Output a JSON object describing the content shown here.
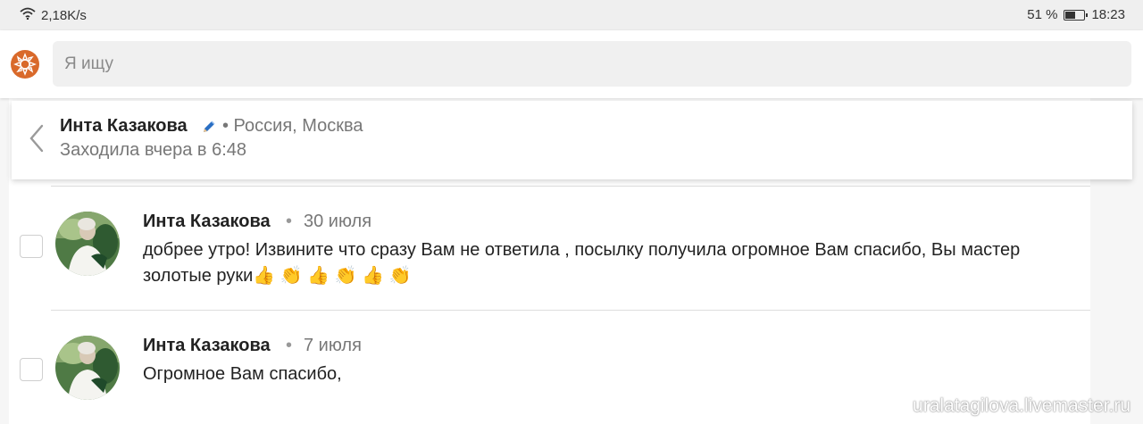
{
  "status_bar": {
    "speed": "2,18K/s",
    "battery_percent": "51 %",
    "time": "18:23"
  },
  "search": {
    "placeholder": "Я ищу"
  },
  "profile": {
    "name": "Инта Казакова",
    "location": "• Россия, Москва",
    "last_seen": "Заходила вчера в 6:48"
  },
  "messages": [
    {
      "author": "Инта Казакова",
      "dot": "•",
      "date": "30 июля",
      "text": "добрее утро! Извините что сразу Вам не ответила , посылку получила огромное Вам спасибо, Вы мастер золотые руки👍 👏 👍 👏 👍 👏"
    },
    {
      "author": "Инта Казакова",
      "dot": "•",
      "date": "7 июля",
      "text": "Огромное Вам спасибо,"
    }
  ],
  "watermark": {
    "text": "uralatagilova.livemaster.ru"
  },
  "colors": {
    "brand": "#d9692a",
    "accent_pencil": "#2a6fc4"
  }
}
